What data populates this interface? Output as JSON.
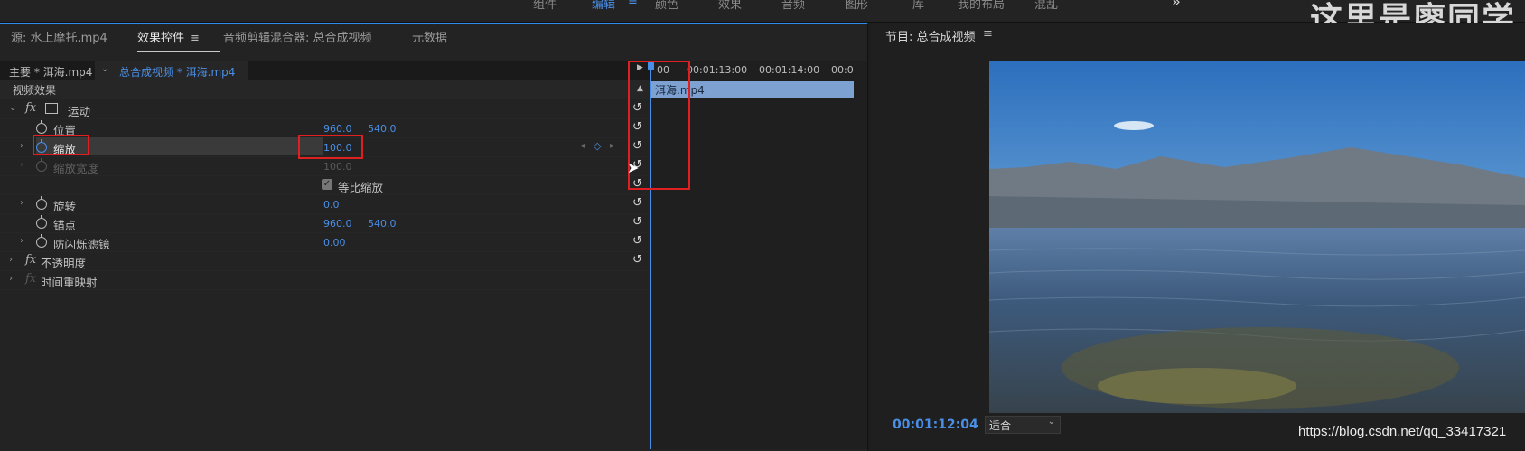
{
  "workspaces": [
    "组件",
    "编辑",
    "颜色",
    "效果",
    "音频",
    "图形",
    "库",
    "我的布局",
    "混乱"
  ],
  "more_chevron": "»",
  "watermark": "这里是廖同学",
  "tabs": {
    "source": "源: 水上摩托.mp4",
    "effect_controls": "效果控件",
    "audio_mixer": "音频剪辑混合器: 总合成视频",
    "metadata": "元数据"
  },
  "breadcrumb": {
    "master": "主要 * 洱海.mp4",
    "sequence": "总合成视频 * 洱海.mp4"
  },
  "video_effects_heading": "视频效果",
  "effects": {
    "motion": "运动",
    "position": {
      "label": "位置",
      "x": "960.0",
      "y": "540.0"
    },
    "scale": {
      "label": "缩放",
      "value": "100.0"
    },
    "scale_width": {
      "label": "缩放宽度",
      "value": "100.0"
    },
    "uniform_scale": "等比缩放",
    "rotation": {
      "label": "旋转",
      "value": "0.0"
    },
    "anchor": {
      "label": "锚点",
      "x": "960.0",
      "y": "540.0"
    },
    "anti_flicker": {
      "label": "防闪烁滤镜",
      "value": "0.00"
    },
    "opacity": "不透明度",
    "time_remap": "时间重映射"
  },
  "timeline": {
    "ticks": [
      "00",
      "00:01:13:00",
      "00:01:14:00",
      "00:0"
    ],
    "clip_name": "洱海.mp4"
  },
  "program": {
    "title": "节目: 总合成视频",
    "timecode": "00:01:12:04",
    "fit": "适合"
  },
  "url": "https://blog.csdn.net/qq_33417321",
  "colors": {
    "accent": "#4a8fe7",
    "highlight_box": "#e02020"
  }
}
